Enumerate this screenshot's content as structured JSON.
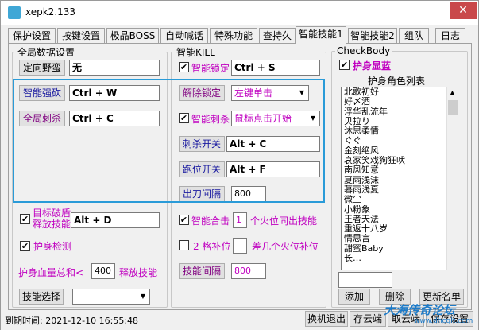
{
  "window": {
    "title": "xepk2.133",
    "close_glyph": "✕",
    "minimize_glyph": "—"
  },
  "tabs": [
    "保护设置",
    "按键设置",
    "极品BOSS",
    "自动喊话",
    "特殊功能",
    "查持久",
    "智能技能1",
    "智能技能2",
    "组队",
    "日志"
  ],
  "left": {
    "legend": "全局数据设置",
    "dingxiang_btn": "定向野蛮",
    "dingxiang_val": "无",
    "zhineng_qiangkan_btn": "智能强砍",
    "zhineng_qiangkan_val": "Ctrl + W",
    "quanju_cisha_btn": "全局刺杀",
    "quanju_cisha_val": "Ctrl + C",
    "mubiao_line1": "目标破盾",
    "mubiao_line2": "释放技能",
    "mubiao_val": "Alt + D",
    "hushen_jiance": "护身检测",
    "xueliang_label": "护身血量总和<",
    "xueliang_val": "400",
    "xueliang_suffix": "释放技能",
    "jineng_xuanze_btn": "技能选择",
    "jineng_xuanze_val": ""
  },
  "mid": {
    "legend": "智能KILL",
    "suoding_label": "智能锁定",
    "suoding_val": "Ctrl + S",
    "jiechu_btn": "解除锁定",
    "jiechu_val": "左键单击",
    "cisha_label": "智能刺杀",
    "cisha_val": "鼠标点击开始",
    "cisha_kaiguan_btn": "刺杀开关",
    "cisha_kaiguan_val": "Alt + C",
    "paowei_btn": "跑位开关",
    "paowei_val": "Alt + F",
    "chudao_btn": "出刀间隔",
    "chudao_val": "800",
    "heji_label": "智能合击",
    "heji_num": "1",
    "heji_suffix": "个火位同出技能",
    "buwei_label": "2 格补位",
    "buwei_suffix": "差几个火位补位",
    "jineng_jiange_btn": "技能间隔",
    "jineng_jiange_val": "800"
  },
  "right": {
    "legend": "CheckBody",
    "hushen_xianlan": "护身显蓝",
    "list_title": "护身角色列表",
    "roles": [
      "北歌初好",
      "好〆酒",
      "浮华乱流年",
      "贝拉り",
      "沐思柔情",
      "ぐぐ",
      "金刻绝风",
      "哀家笑戏狗狂吠",
      "南风知意",
      "夏雨浅沫",
      "暮雨浅夏",
      "微尘",
      "小粉象",
      "王者天法",
      "重返十八岁",
      "情思言",
      "甜蜜Baby",
      "长…"
    ],
    "name_input": "",
    "add_btn": "添加",
    "del_btn": "删除",
    "refresh_btn": "更新名单"
  },
  "status": {
    "expire": "到期时间: 2021-12-10  16:55:48",
    "logout_btn": "换机退出",
    "save_cloud_btn": "存云端",
    "fetch_cloud_btn": "取云端",
    "save_settings_btn": "保存设置"
  },
  "watermark": {
    "title": "大海传奇论坛",
    "url": "www.dhcqlt.com"
  }
}
